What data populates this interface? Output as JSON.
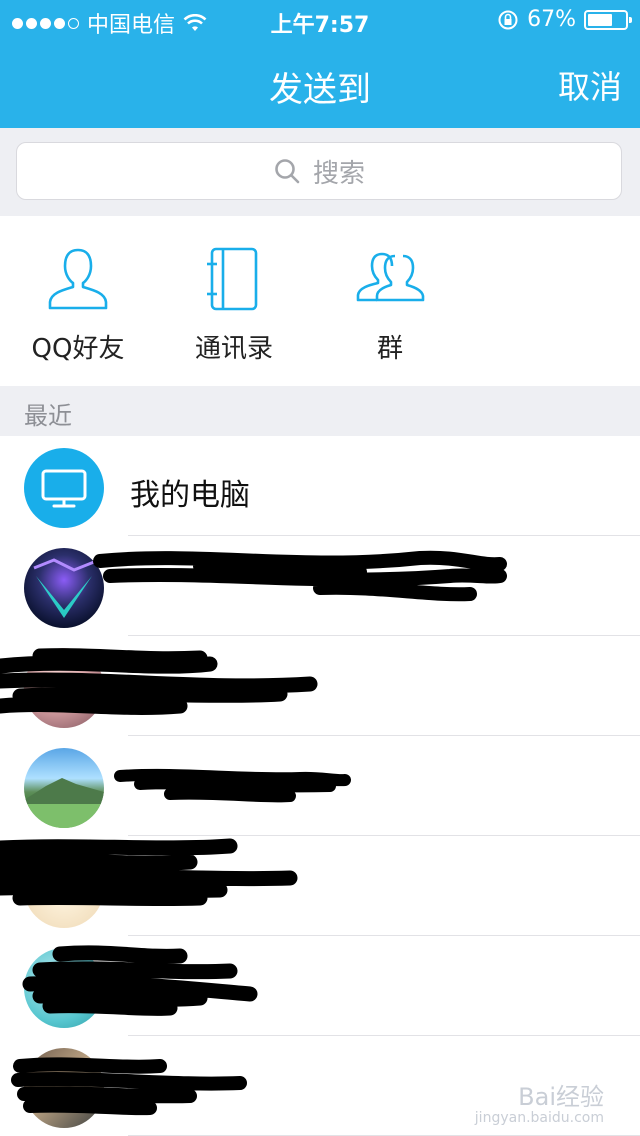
{
  "status_bar": {
    "carrier": "中国电信",
    "time": "上午7:57",
    "battery": "67%",
    "battery_level": 0.67,
    "signal_bars": 4
  },
  "nav": {
    "title": "发送到",
    "cancel": "取消"
  },
  "search": {
    "placeholder": "搜索"
  },
  "quick_entries": [
    {
      "label": "QQ好友",
      "icon": "person-icon"
    },
    {
      "label": "通讯录",
      "icon": "contacts-book-icon"
    },
    {
      "label": "群",
      "icon": "group-icon"
    }
  ],
  "section": {
    "title": "最近"
  },
  "recent": [
    {
      "name": "我的电脑",
      "avatar": "monitor-icon"
    },
    {
      "name": "",
      "avatar": "game-avatar"
    },
    {
      "name": "",
      "avatar": "pink-avatar"
    },
    {
      "name": "",
      "avatar": "landscape-avatar"
    },
    {
      "name": "",
      "avatar": "cream-avatar"
    },
    {
      "name": "",
      "avatar": "teal-avatar"
    },
    {
      "name": "",
      "avatar": "photo-avatar"
    }
  ],
  "watermark": {
    "brand": "Bai经验",
    "url": "jingyan.baidu.com"
  },
  "colors": {
    "accent": "#29b2ea",
    "background": "#eeeff3"
  }
}
